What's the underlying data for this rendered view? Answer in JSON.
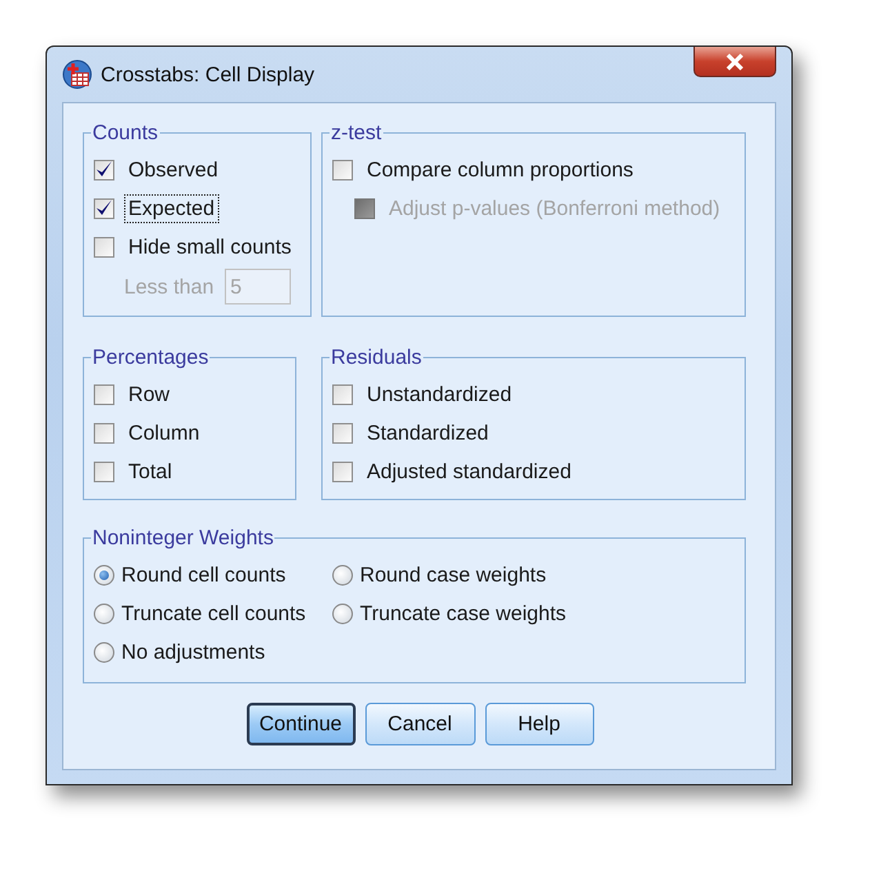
{
  "window": {
    "title": "Crosstabs: Cell Display"
  },
  "counts": {
    "title": "Counts",
    "options": [
      {
        "label": "Observed",
        "checked": true,
        "focused": false
      },
      {
        "label": "Expected",
        "checked": true,
        "focused": true
      },
      {
        "label": "Hide small counts",
        "checked": false,
        "focused": false
      }
    ],
    "less_than": {
      "label": "Less than",
      "value": "5",
      "disabled": true
    }
  },
  "z_test": {
    "title": "z-test",
    "options": [
      {
        "label": "Compare column proportions",
        "checked": false,
        "disabled": false,
        "kind": "option"
      },
      {
        "label": "Adjust p-values (Bonferroni method)",
        "checked": false,
        "disabled": true,
        "kind": "sub_option"
      }
    ]
  },
  "percentages": {
    "title": "Percentages",
    "options": [
      {
        "label": "Row",
        "checked": false
      },
      {
        "label": "Column",
        "checked": false
      },
      {
        "label": "Total",
        "checked": false
      }
    ]
  },
  "residuals": {
    "title": "Residuals",
    "options": [
      {
        "label": "Unstandardized",
        "checked": false
      },
      {
        "label": "Standardized",
        "checked": false
      },
      {
        "label": "Adjusted standardized",
        "checked": false
      }
    ]
  },
  "noninteger_weights": {
    "title": "Noninteger Weights",
    "options": [
      {
        "label": "Round cell counts",
        "selected": true
      },
      {
        "label": "Round case weights",
        "selected": false
      },
      {
        "label": "Truncate cell counts",
        "selected": false
      },
      {
        "label": "Truncate case weights",
        "selected": false
      },
      {
        "label": "No adjustments",
        "selected": false
      }
    ]
  },
  "buttons": [
    {
      "label": "Continue",
      "default": true
    },
    {
      "label": "Cancel",
      "default": false
    },
    {
      "label": "Help",
      "default": false
    }
  ]
}
